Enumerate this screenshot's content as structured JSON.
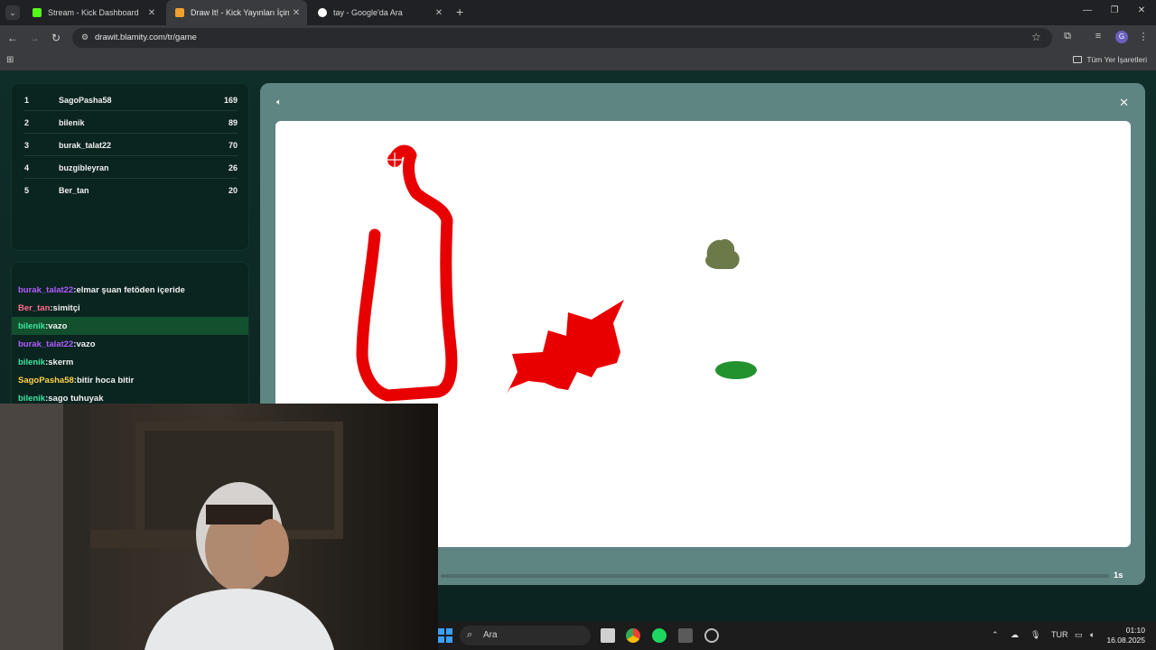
{
  "browser": {
    "tabs": [
      {
        "title": "Stream - Kick Dashboard",
        "favicon_color": "#53fc18",
        "active": false
      },
      {
        "title": "Draw It! - Kick Yayınları İçin Çizim",
        "favicon_color": "#f0a030",
        "active": true
      },
      {
        "title": "tay - Google'da Ara",
        "favicon_color": "#ffffff",
        "active": false
      }
    ],
    "url": "drawit.blamity.com/tr/game",
    "bookmarks_all_label": "Tüm Yer İşaretleri",
    "profile_initial": "G"
  },
  "leaderboard": [
    {
      "rank": "1",
      "name": "SagoPasha58",
      "points": "169"
    },
    {
      "rank": "2",
      "name": "bilenik",
      "points": "89"
    },
    {
      "rank": "3",
      "name": "burak_talat22",
      "points": "70"
    },
    {
      "rank": "4",
      "name": "buzgibleyran",
      "points": "26"
    },
    {
      "rank": "5",
      "name": "Ber_tan",
      "points": "20"
    }
  ],
  "chat": [
    {
      "user": "burak_talat22",
      "user_color": "#b15cff",
      "message": "elmar şuan fetöden içeride",
      "highlighted": false
    },
    {
      "user": "Ber_tan",
      "user_color": "#ff6f8e",
      "message": "simitçi",
      "highlighted": false
    },
    {
      "user": "bilenik",
      "user_color": "#3ee6a0",
      "message": "vazo",
      "highlighted": true
    },
    {
      "user": "burak_talat22",
      "user_color": "#b15cff",
      "message": "vazo",
      "highlighted": false
    },
    {
      "user": "bilenik",
      "user_color": "#3ee6a0",
      "message": "skerm",
      "highlighted": false
    },
    {
      "user": "SagoPasha58",
      "user_color": "#ffd24a",
      "message": "bitir hoca bitir",
      "highlighted": false
    },
    {
      "user": "bilenik",
      "user_color": "#3ee6a0",
      "message": "sago tuhuyak",
      "highlighted": false
    }
  ],
  "game": {
    "timer": "1s",
    "colors": {
      "red": "#e80000",
      "olive": "#6b7a48",
      "green": "#22922e"
    }
  },
  "taskbar": {
    "search_label": "Ara",
    "lang": "TUR",
    "time": "01:10",
    "date": "16.08.2025"
  }
}
